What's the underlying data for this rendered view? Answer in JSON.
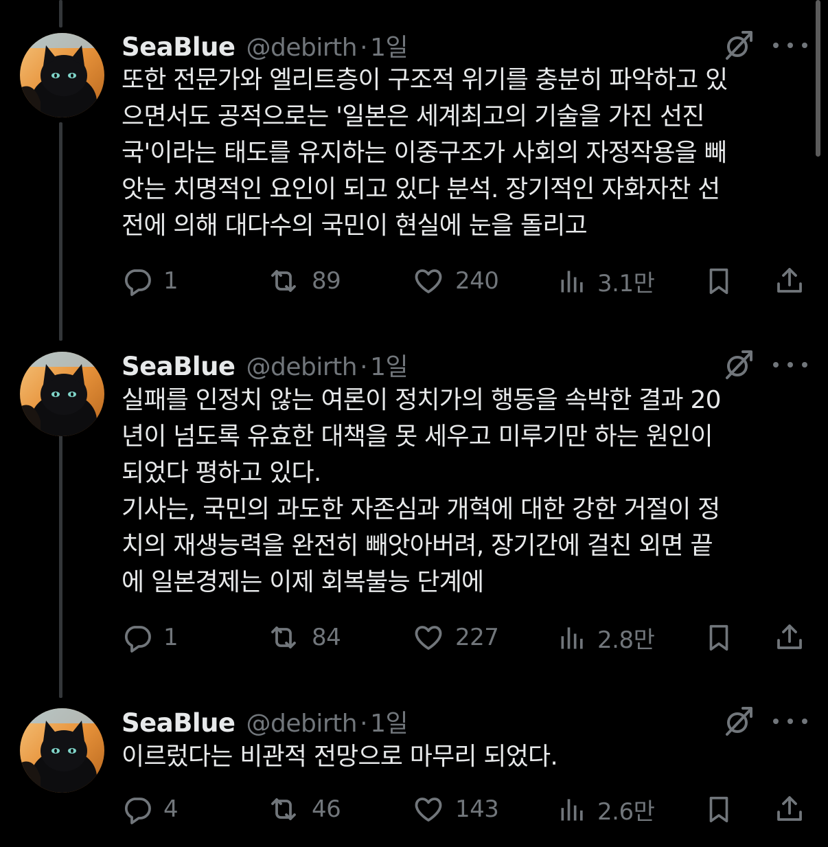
{
  "tweets": [
    {
      "name": "SeaBlue",
      "handle": "@debirth",
      "separator": "·",
      "time": "1일",
      "text": "또한 전문가와 엘리트층이 구조적 위기를 충분히 파악하고 있\n으면서도 공적으로는 '일본은 세계최고의 기술을 가진 선진\n국'이라는 태도를 유지하는 이중구조가 사회의 자정작용을 빼\n앗는 치명적인 요인이 되고 있다 분석. 장기적인 자화자찬 선\n전에 의해 대다수의 국민이 현실에 눈을 돌리고",
      "replies": "1",
      "retweets": "89",
      "likes": "240",
      "views": "3.1만"
    },
    {
      "name": "SeaBlue",
      "handle": "@debirth",
      "separator": "·",
      "time": "1일",
      "text": "실패를 인정치 않는 여론이 정치가의 행동을 속박한 결과 20\n년이 넘도록 유효한 대책을 못 세우고 미루기만 하는 원인이\n되었다 평하고 있다.\n기사는, 국민의 과도한 자존심과 개혁에 대한 강한 거절이 정\n치의 재생능력을 완전히 빼앗아버려, 장기간에 걸친 외면 끝\n에 일본경제는 이제 회복불능 단계에",
      "replies": "1",
      "retweets": "84",
      "likes": "227",
      "views": "2.8만"
    },
    {
      "name": "SeaBlue",
      "handle": "@debirth",
      "separator": "·",
      "time": "1일",
      "text": "이르렀다는 비관적 전망으로 마무리 되었다.",
      "replies": "4",
      "retweets": "46",
      "likes": "143",
      "views": "2.6만"
    }
  ],
  "icons": {
    "reply": "reply-icon",
    "retweet": "retweet-icon",
    "like": "heart-icon",
    "views": "views-icon",
    "bookmark": "bookmark-icon",
    "share": "share-icon",
    "grok": "grok-icon",
    "more": "more-icon"
  },
  "colors": {
    "background": "#000000",
    "text": "#e7e9ea",
    "secondary": "#71767b",
    "thread_line": "#333639"
  }
}
